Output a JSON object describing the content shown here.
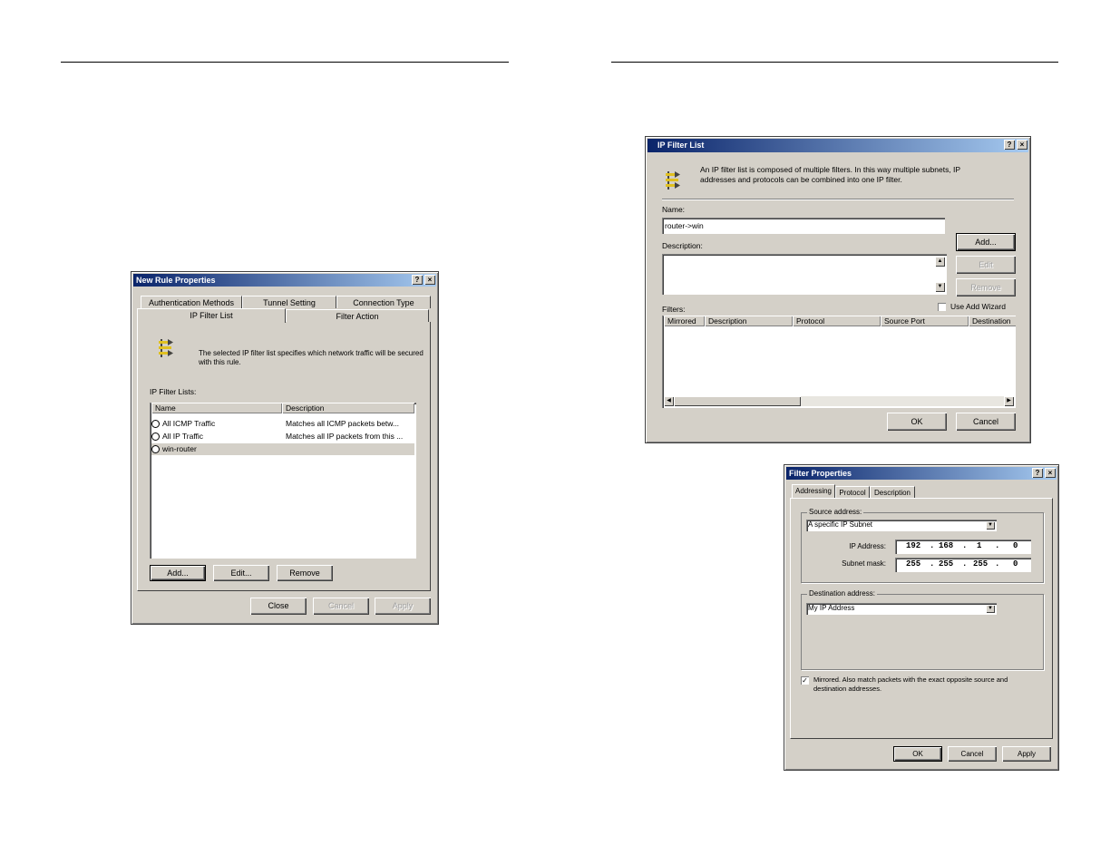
{
  "new_rule": {
    "title": "New Rule Properties",
    "help": "?",
    "close": "×",
    "tabs_row1": [
      "Authentication Methods",
      "Tunnel Setting",
      "Connection Type"
    ],
    "tabs_row2": [
      "IP Filter List",
      "Filter Action"
    ],
    "description": "The selected IP filter list specifies which network traffic will be secured with this rule.",
    "list_label": "IP Filter Lists:",
    "columns": [
      "Name",
      "Description"
    ],
    "rows": [
      {
        "name": "All ICMP Traffic",
        "description": "Matches all ICMP packets betw..."
      },
      {
        "name": "All IP Traffic",
        "description": "Matches all IP packets from this ..."
      },
      {
        "name": "win-router",
        "description": ""
      }
    ],
    "buttons": {
      "add": "Add...",
      "edit": "Edit...",
      "remove": "Remove"
    },
    "footer": {
      "close": "Close",
      "cancel": "Cancel",
      "apply": "Apply"
    }
  },
  "ip_filter_list": {
    "title": "IP Filter List",
    "help": "?",
    "close": "×",
    "intro": "An IP filter list is composed of multiple filters. In this way multiple subnets, IP addresses and protocols can be combined into one IP filter.",
    "name_label": "Name:",
    "name_value": "router->win",
    "description_label": "Description:",
    "buttons": {
      "add": "Add...",
      "edit": "Edit",
      "remove": "Remove"
    },
    "filters_label": "Filters:",
    "use_wizard": "Use Add Wizard",
    "columns": [
      "Mirrored",
      "Description",
      "Protocol",
      "Source Port",
      "Destination"
    ],
    "footer": {
      "ok": "OK",
      "cancel": "Cancel"
    }
  },
  "filter_properties": {
    "title": "Filter Properties",
    "help": "?",
    "close": "×",
    "tabs": [
      "Addressing",
      "Protocol",
      "Description"
    ],
    "source_group": "Source address:",
    "source_select": "A specific IP Subnet",
    "ip_label": "IP Address:",
    "ip_octets": [
      "192",
      "168",
      "1",
      "0"
    ],
    "mask_label": "Subnet mask:",
    "mask_octets": [
      "255",
      "255",
      "255",
      "0"
    ],
    "dest_group": "Destination address:",
    "dest_select": "My IP Address",
    "mirrored_check": "✓",
    "mirrored_text": "Mirrored. Also match packets with the exact opposite source and destination addresses.",
    "footer": {
      "ok": "OK",
      "cancel": "Cancel",
      "apply": "Apply"
    }
  }
}
